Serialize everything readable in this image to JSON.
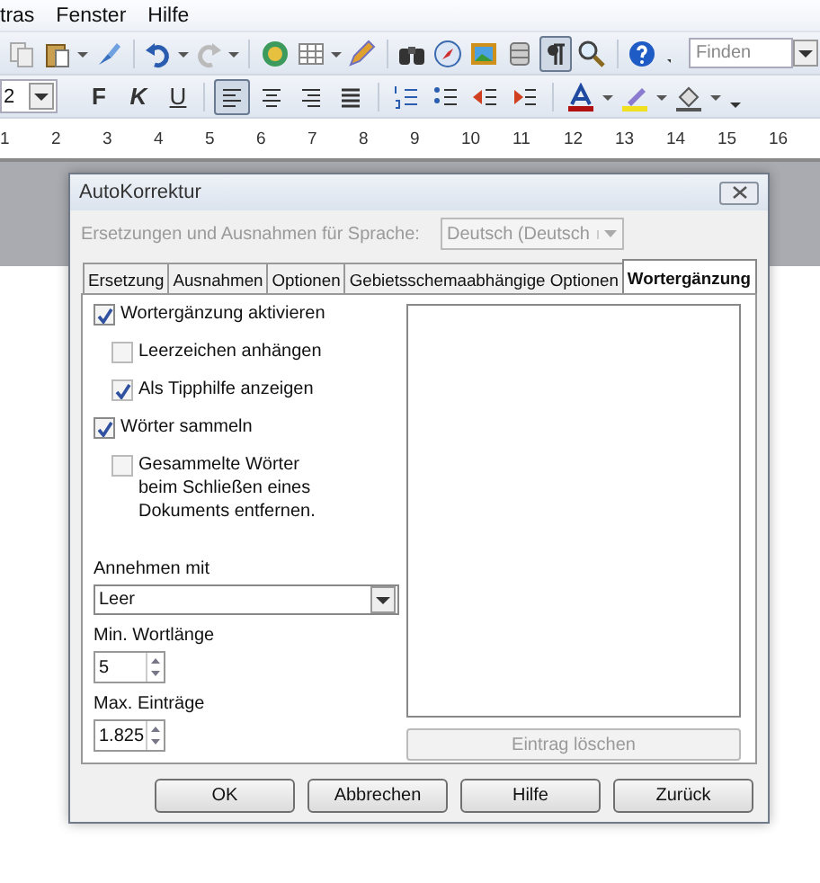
{
  "menu": [
    {
      "label": "tras"
    },
    {
      "label": "Fenster"
    },
    {
      "label": "Hilfe"
    }
  ],
  "toolbar": {
    "paragraph_marks_on": true,
    "search": {
      "placeholder": "Finden"
    }
  },
  "format_bar": {
    "font_size": "2",
    "style_buttons": [
      "F",
      "K",
      "U"
    ],
    "alignment": [
      {
        "kind": "left",
        "selected": true
      },
      {
        "kind": "center",
        "selected": false
      },
      {
        "kind": "right",
        "selected": false
      },
      {
        "kind": "justify",
        "selected": false
      }
    ]
  },
  "ruler": [
    "1",
    "2",
    "3",
    "4",
    "5",
    "6",
    "7",
    "8",
    "9",
    "10",
    "11",
    "12",
    "13",
    "14",
    "15",
    "16"
  ],
  "dialog": {
    "title": "AutoKorrektur",
    "language_label": "Ersetzungen und Ausnahmen für Sprache:",
    "language_value": "Deutsch (Deutsch",
    "tabs": [
      {
        "label": "Ersetzung",
        "selected": false
      },
      {
        "label": "Ausnahmen",
        "selected": false
      },
      {
        "label": "Optionen",
        "selected": false
      },
      {
        "label": "Gebietsschemaabhängige Optionen",
        "selected": false
      },
      {
        "label": "Wortergänzung",
        "selected": true
      }
    ],
    "options": [
      {
        "label": "Wortergänzung aktivieren",
        "checked": true,
        "children": [
          {
            "label": "Leerzeichen anhängen",
            "checked": false
          },
          {
            "label": "Als Tipphilfe anzeigen",
            "checked": true
          }
        ]
      },
      {
        "label": "Wörter sammeln",
        "checked": true,
        "children": [
          {
            "label": "Gesammelte Wörter beim Schließen eines Dokuments entfernen.",
            "checked": false
          }
        ]
      }
    ],
    "accept_label": "Annehmen mit",
    "accept_value": "Leer",
    "min_label": "Min. Wortlänge",
    "min_value": "5",
    "max_label": "Max. Einträge",
    "max_value": "1.825",
    "delete_button": {
      "label": "Eintrag löschen",
      "disabled": true
    },
    "buttons": [
      "OK",
      "Abbrechen",
      "Hilfe",
      "Zurück"
    ]
  }
}
